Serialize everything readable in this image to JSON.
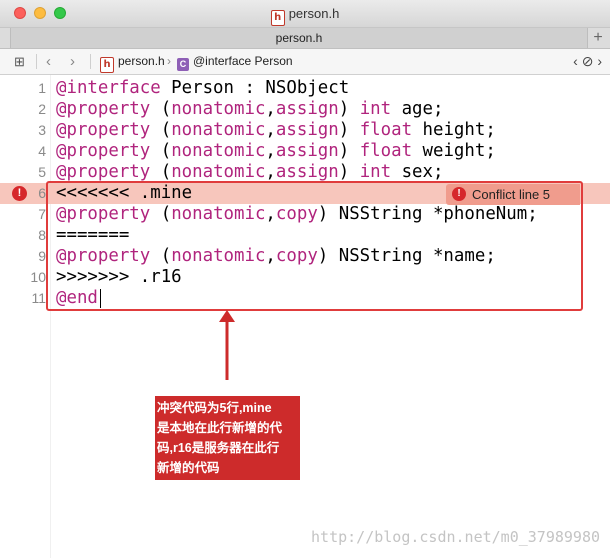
{
  "window": {
    "title": "person.h",
    "tab_label": "person.h",
    "tab_add": "+"
  },
  "jumpbar": {
    "grid_icon": "grid-icon",
    "back_icon": "chevron-left-icon",
    "forward_icon": "chevron-right-icon",
    "file_name": "person.h",
    "symbol": "@interface Person",
    "right_controls": "‹ ⊘ ›"
  },
  "code_lines": [
    {
      "num": "1",
      "text": "@interface Person : NSObject"
    },
    {
      "num": "2",
      "text": "@property (nonatomic,assign) int age;"
    },
    {
      "num": "3",
      "text": "@property (nonatomic,assign) float height;"
    },
    {
      "num": "4",
      "text": "@property (nonatomic,assign) float weight;"
    },
    {
      "num": "5",
      "text": "@property (nonatomic,assign) int sex;"
    },
    {
      "num": "6",
      "text": "<<<<<<< .mine"
    },
    {
      "num": "7",
      "text": "@property (nonatomic,copy) NSString *phoneNum;"
    },
    {
      "num": "8",
      "text": "======="
    },
    {
      "num": "9",
      "text": "@property (nonatomic,copy) NSString *name;"
    },
    {
      "num": "10",
      "text": ">>>>>>> .r16"
    },
    {
      "num": "11",
      "text": "@end"
    }
  ],
  "conflict": {
    "label": "Conflict line 5",
    "error_glyph": "!"
  },
  "annotation": {
    "lines": [
      "冲突代码为5行,mine",
      "是本地在此行新增的代",
      "码,r16是服务器在此行",
      "新增的代码"
    ]
  },
  "watermark": "http://blog.csdn.net/m0_37989980",
  "colors": {
    "keyword": "#b0247d",
    "conflict_bg": "#f7c6bc",
    "annotation_bg": "#cd2b2b",
    "box_border": "#e03c3c"
  }
}
